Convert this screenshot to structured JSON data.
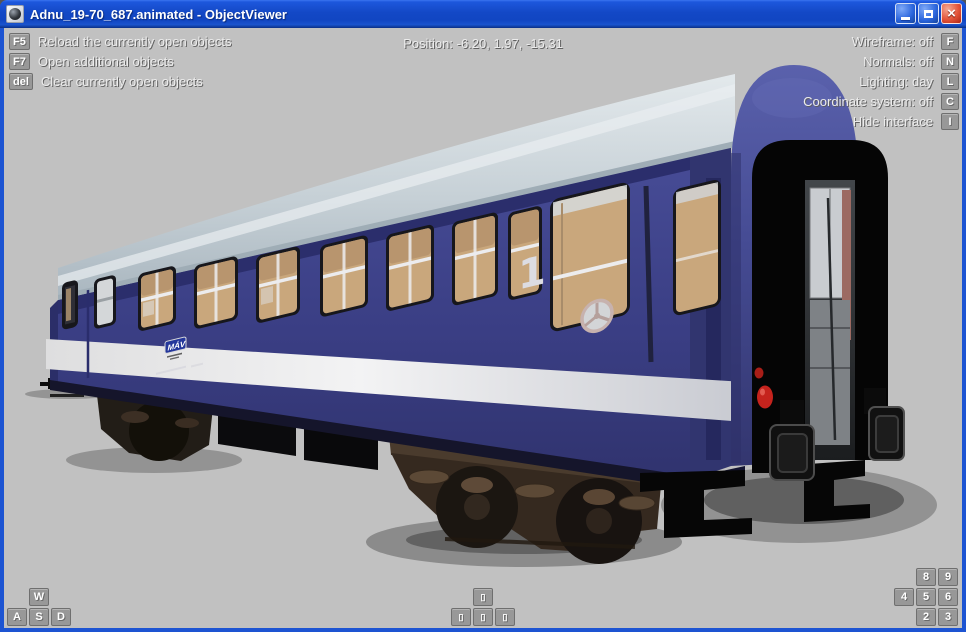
{
  "window": {
    "title": "Adnu_19-70_687.animated - ObjectViewer",
    "icons": {
      "close": "×"
    }
  },
  "hud": {
    "position_label": "Position: -6.20, 1.97, -15.31",
    "left_help": [
      {
        "key": "F5",
        "label": "Reload the currently open objects"
      },
      {
        "key": "F7",
        "label": "Open additional objects"
      },
      {
        "key": "del",
        "label": "Clear currently open objects"
      }
    ],
    "right_help": [
      {
        "label": "Wireframe: off",
        "key": "F"
      },
      {
        "label": "Normals: off",
        "key": "N"
      },
      {
        "label": "Lighting: day",
        "key": "L"
      },
      {
        "label": "Coordinate system: off",
        "key": "C"
      },
      {
        "label": "Hide interface",
        "key": "I"
      }
    ],
    "wasd": {
      "up": "W",
      "left": "A",
      "down": "S",
      "right": "D"
    },
    "arrows": {
      "glyph": "▯"
    },
    "numpad": {
      "r1": [
        "8",
        "9"
      ],
      "r2": [
        "4",
        "5",
        "6"
      ],
      "r3": [
        "2",
        "3"
      ]
    }
  },
  "train": {
    "class_marker": "1",
    "logo": "MÁV"
  },
  "colors": {
    "viewport_bg": "#c1c1c1",
    "car_body_blue": "#3d4189",
    "roof_gray": "#c6d0d6",
    "stripe_white": "#eeeef0",
    "marker_light_red": "#c5231d",
    "titlebar_blue": "#1348c6"
  }
}
